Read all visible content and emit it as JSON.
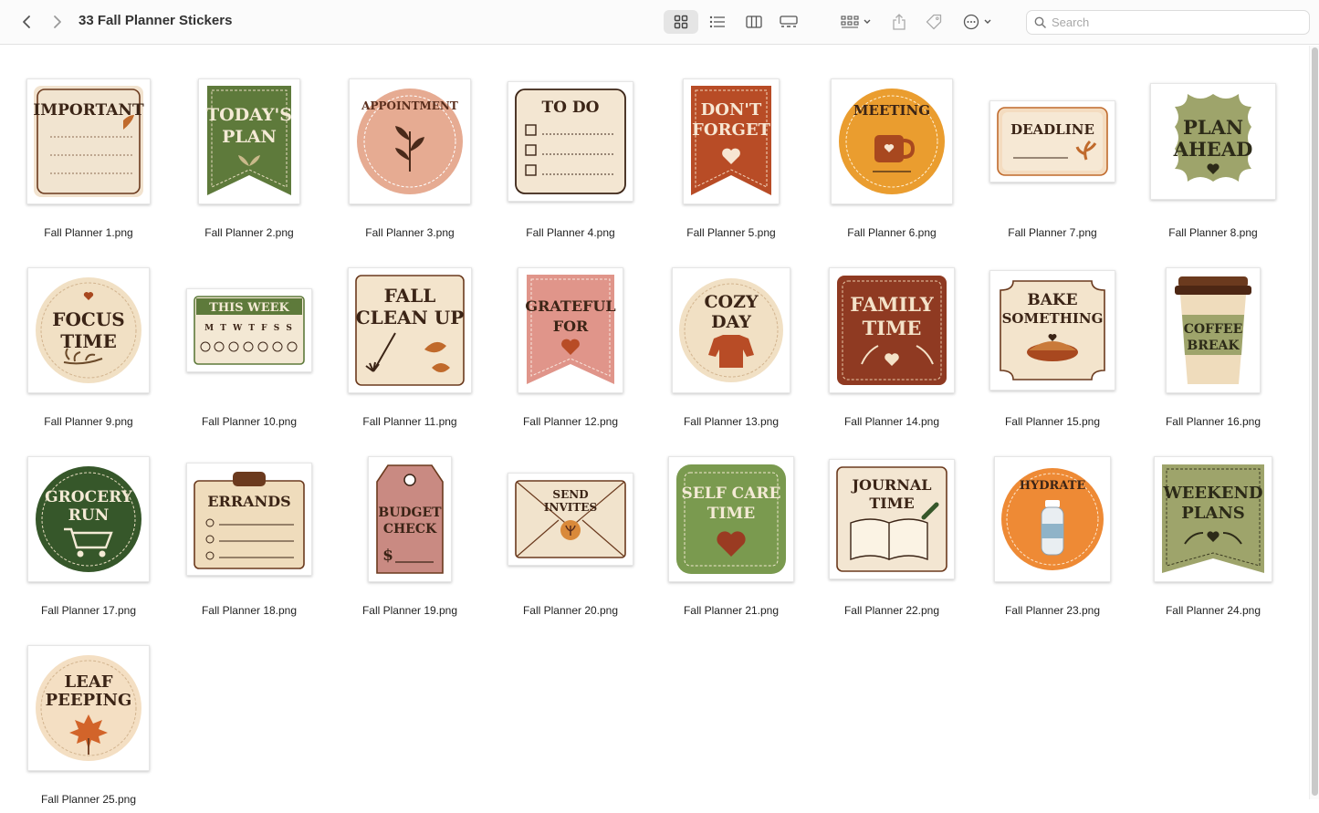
{
  "window": {
    "title": "33 Fall Planner Stickers"
  },
  "toolbar": {
    "search_placeholder": "Search",
    "view_modes": [
      "icon-view",
      "list-view",
      "column-view",
      "gallery-view"
    ],
    "active_view": "icon-view"
  },
  "files": [
    {
      "name": "Fall Planner 1.png",
      "lines": [
        "IMPORTANT"
      ]
    },
    {
      "name": "Fall Planner 2.png",
      "lines": [
        "TODAY'S",
        "PLAN"
      ]
    },
    {
      "name": "Fall Planner 3.png",
      "lines": [
        "APPOINTMENT"
      ]
    },
    {
      "name": "Fall Planner 4.png",
      "lines": [
        "TO DO"
      ]
    },
    {
      "name": "Fall Planner 5.png",
      "lines": [
        "DON'T",
        "FORGET"
      ]
    },
    {
      "name": "Fall Planner 6.png",
      "lines": [
        "MEETING"
      ]
    },
    {
      "name": "Fall Planner 7.png",
      "lines": [
        "DEADLINE"
      ]
    },
    {
      "name": "Fall Planner 8.png",
      "lines": [
        "PLAN",
        "AHEAD"
      ]
    },
    {
      "name": "Fall Planner 9.png",
      "lines": [
        "FOCUS",
        "TIME"
      ]
    },
    {
      "name": "Fall Planner 10.png",
      "lines": [
        "THIS WEEK",
        "M T W T F S S"
      ]
    },
    {
      "name": "Fall Planner 11.png",
      "lines": [
        "FALL",
        "CLEAN UP"
      ]
    },
    {
      "name": "Fall Planner 12.png",
      "lines": [
        "GRATEFUL",
        "FOR"
      ]
    },
    {
      "name": "Fall Planner 13.png",
      "lines": [
        "COZY",
        "DAY"
      ]
    },
    {
      "name": "Fall Planner 14.png",
      "lines": [
        "FAMILY",
        "TIME"
      ]
    },
    {
      "name": "Fall Planner 15.png",
      "lines": [
        "BAKE",
        "SOMETHING"
      ]
    },
    {
      "name": "Fall Planner 16.png",
      "lines": [
        "COFFEE",
        "BREAK"
      ]
    },
    {
      "name": "Fall Planner 17.png",
      "lines": [
        "GROCERY",
        "RUN"
      ]
    },
    {
      "name": "Fall Planner 18.png",
      "lines": [
        "ERRANDS"
      ]
    },
    {
      "name": "Fall Planner 19.png",
      "lines": [
        "BUDGET",
        "CHECK",
        "$"
      ]
    },
    {
      "name": "Fall Planner 20.png",
      "lines": [
        "SEND",
        "INVITES"
      ]
    },
    {
      "name": "Fall Planner 21.png",
      "lines": [
        "SELF CARE",
        "TIME"
      ]
    },
    {
      "name": "Fall Planner 22.png",
      "lines": [
        "JOURNAL",
        "TIME"
      ]
    },
    {
      "name": "Fall Planner 23.png",
      "lines": [
        "HYDRATE"
      ]
    },
    {
      "name": "Fall Planner 24.png",
      "lines": [
        "WEEKEND",
        "PLANS"
      ]
    },
    {
      "name": "Fall Planner 25.png",
      "lines": [
        "LEAF",
        "PEEPING"
      ]
    }
  ]
}
